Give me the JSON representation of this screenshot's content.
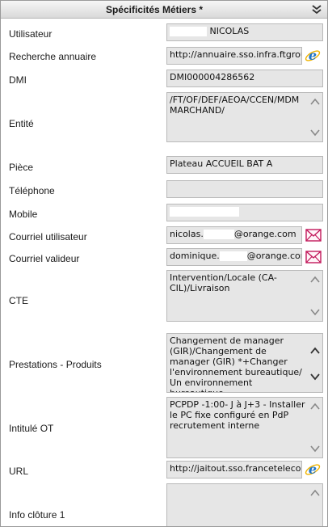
{
  "panel": {
    "title": "Spécificités Métiers *",
    "collapse_icon": "chevron-double-down-icon"
  },
  "fields": {
    "utilisateur": {
      "label": "Utilisateur",
      "value": "NICOLAS"
    },
    "recherche_annuaire": {
      "label": "Recherche annuaire",
      "value": "http://annuaire.sso.infra.ftgroup/"
    },
    "dmi": {
      "label": "DMI",
      "value": "DMI000004286562"
    },
    "entite": {
      "label": "Entité",
      "value": "/FT/OF/DEF/AEOA/CCEN/MDM MARCHAND/"
    },
    "piece": {
      "label": "Pièce",
      "value": "Plateau ACCUEIL BAT A"
    },
    "telephone": {
      "label": "Téléphone",
      "value": ""
    },
    "mobile": {
      "label": "Mobile",
      "value": ""
    },
    "courriel_utilisateur": {
      "label": "Courriel utilisateur",
      "value_prefix": "nicolas.",
      "value_suffix": "@orange.com"
    },
    "courriel_valideur": {
      "label": "Courriel valideur",
      "value_prefix": "dominique.",
      "value_suffix": "@orange.com"
    },
    "cte": {
      "label": "CTE",
      "value": "Intervention/Locale (CA-CIL)/Livraison"
    },
    "prestations": {
      "label": "Prestations - Produits",
      "value": "Changement de manager (GIR)/Changement de manager (GIR) *+Changer l'environnement bureautique/ Un environnement bureautique"
    },
    "intitule_ot": {
      "label": "Intitulé OT",
      "value": "PCPDP -1:00- J à J+3 - Installer le PC fixe configuré en PdP recrutement interne"
    },
    "url": {
      "label": "URL",
      "value": "http://jaitout.sso.francetelecom.fr"
    },
    "info_cloture": {
      "label": "Info clôture 1",
      "value": ""
    }
  },
  "icons": {
    "browser": "internet-explorer-icon",
    "mail": "mail-envelope-icon",
    "scroll_up": "scroll-up-arrow-icon",
    "scroll_down": "scroll-down-arrow-icon"
  },
  "colors": {
    "field_background": "#e6e6e6",
    "mail_icon": "#c2185b",
    "ie_icon": "#1e73c8"
  }
}
